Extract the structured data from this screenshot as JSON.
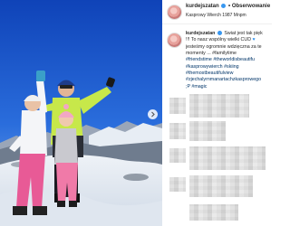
{
  "post": {
    "username": "kurdejszatan",
    "follow_label": "Obserwowanie",
    "location": "Kasprowy Wierch 1987 Mnpm"
  },
  "caption": {
    "username": "kurdejszatan",
    "lines": [
      "Świat jest tak pięk",
      "!!! To nasz wspólny wielki CUD",
      "jesteśmy ogromnie wdzięczna za te",
      "momenty ... #familytime",
      "#friendstime #theworldisbeautifu",
      "#kasprowywierch #skiing",
      "#themostbeautifulview",
      "#zjechalyrnmanartachzkasprowego",
      ";P #magic"
    ]
  },
  "icons": {
    "verified": "verified-badge-icon",
    "heart": "blue-heart-icon",
    "next": "chevron-right-icon"
  },
  "colors": {
    "sky": "#1a55c9",
    "link": "#003569",
    "verified": "#3897f0"
  }
}
